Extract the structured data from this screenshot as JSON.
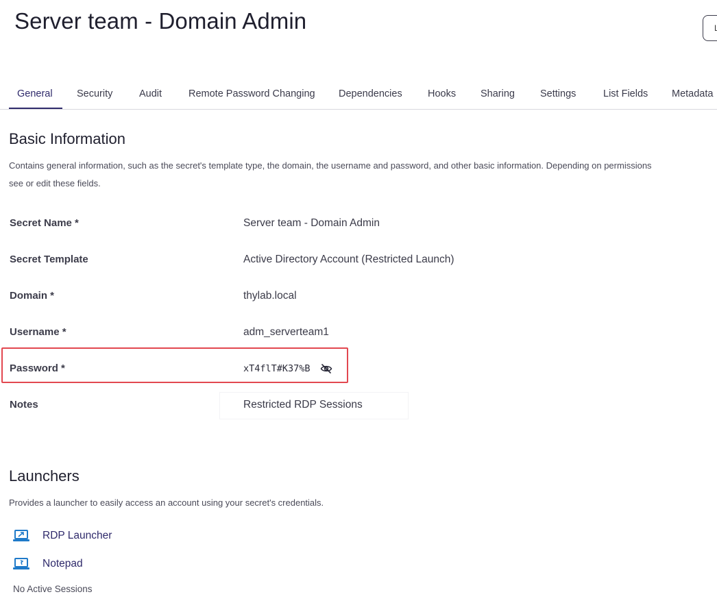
{
  "header": {
    "title": "Server team - Domain Admin",
    "top_button_label": "L"
  },
  "tabs": [
    {
      "label": "General",
      "active": true
    },
    {
      "label": "Security"
    },
    {
      "label": "Audit"
    },
    {
      "label": "Remote Password Changing"
    },
    {
      "label": "Dependencies"
    },
    {
      "label": "Hooks"
    },
    {
      "label": "Sharing"
    },
    {
      "label": "Settings"
    },
    {
      "label": "List Fields"
    },
    {
      "label": "Metadata"
    }
  ],
  "basic_info": {
    "title": "Basic Information",
    "description_line1": "Contains general information, such as the secret's template type, the domain, the username and password, and other basic information. Depending on permissions",
    "description_line2": "see or edit these fields.",
    "fields": [
      {
        "label": "Secret Name *",
        "value": "Server team - Domain Admin"
      },
      {
        "label": "Secret Template",
        "value": "Active Directory Account (Restricted Launch)"
      },
      {
        "label": "Domain *",
        "value": "thylab.local"
      },
      {
        "label": "Username *",
        "value": "adm_serverteam1"
      },
      {
        "label": "Password *",
        "value": "xT4flT#K37%B"
      },
      {
        "label": "Notes",
        "value": "Restricted RDP Sessions"
      }
    ]
  },
  "launchers": {
    "title": "Launchers",
    "description": "Provides a launcher to easily access an account using your secret's credentials.",
    "items": [
      {
        "label": "RDP Launcher",
        "icon": "rdp-launcher-icon"
      },
      {
        "label": "Notepad",
        "icon": "notepad-launcher-icon"
      }
    ],
    "status": "No Active Sessions"
  },
  "colors": {
    "accent": "#2f2a6b",
    "highlight": "#e2474f",
    "launcher_icon": "#1f7ac9"
  }
}
